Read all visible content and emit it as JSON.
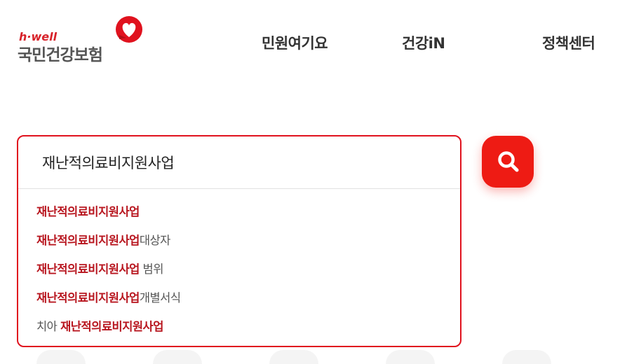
{
  "logo": {
    "small_text": "h·well",
    "main_text": "국민건강보험",
    "icon": "heart-logo-icon"
  },
  "nav": {
    "items": [
      {
        "label": "민원여기요"
      },
      {
        "label": "건강iN"
      },
      {
        "label": "정책센터"
      }
    ]
  },
  "search": {
    "value": "재난적의료비지원사업",
    "button_icon": "search-icon",
    "suggestions": [
      {
        "prefix": "",
        "highlight": "재난적의료비지원사업",
        "suffix": ""
      },
      {
        "prefix": "",
        "highlight": "재난적의료비지원사업",
        "suffix": "대상자"
      },
      {
        "prefix": "",
        "highlight": "재난적의료비지원사업",
        "suffix": " 범위"
      },
      {
        "prefix": "",
        "highlight": "재난적의료비지원사업",
        "suffix": "개별서식"
      },
      {
        "prefix": "치아 ",
        "highlight": "재난적의료비지원사업",
        "suffix": ""
      }
    ]
  },
  "colors": {
    "accent": "#ee1b14",
    "highlight": "#b8161f",
    "border": "#e0121e"
  }
}
